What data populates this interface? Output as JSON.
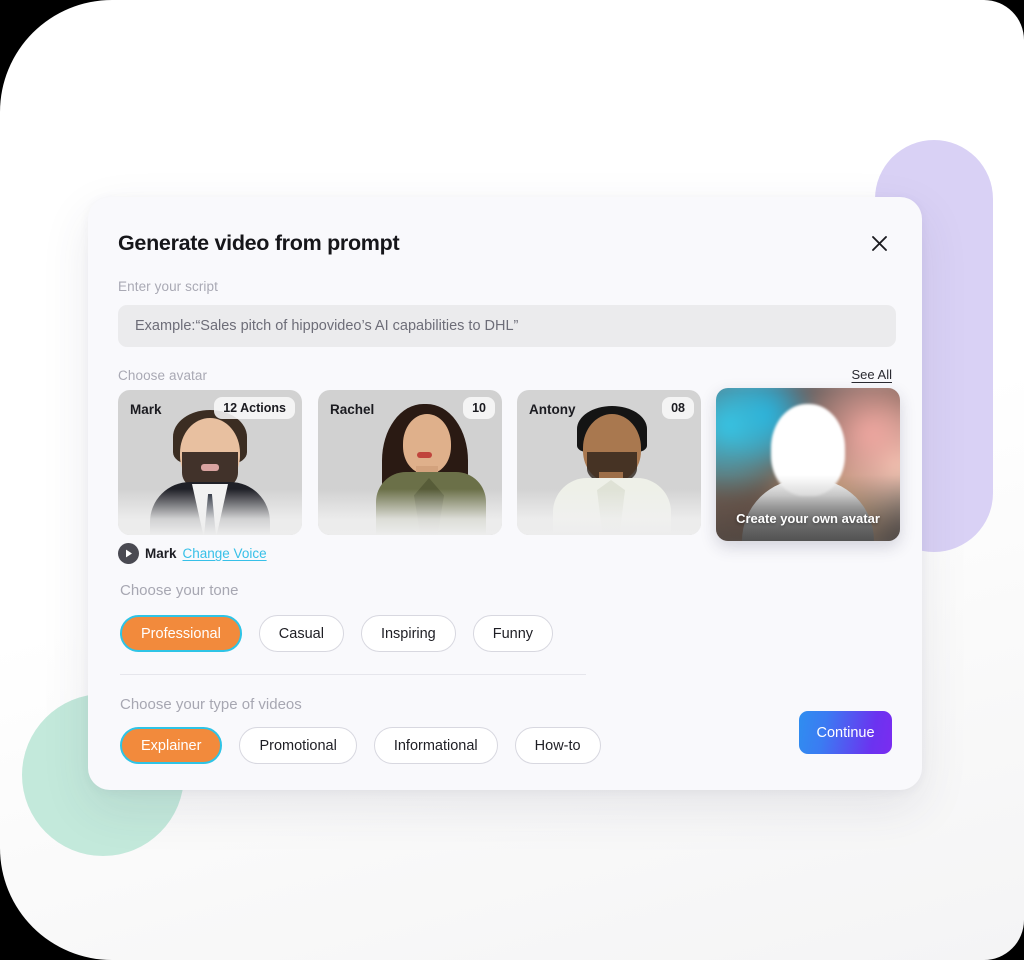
{
  "modal": {
    "title": "Generate video from prompt",
    "close_icon": "close-icon"
  },
  "script": {
    "label": "Enter your script",
    "placeholder": "Example:“Sales pitch of hippovideo’s AI capabilities to DHL”",
    "value": ""
  },
  "avatars": {
    "label": "Choose avatar",
    "see_all_label": "See All",
    "cards": [
      {
        "name": "Mark",
        "badge": "12 Actions",
        "selected": true
      },
      {
        "name": "Rachel",
        "badge": "10",
        "selected": false
      },
      {
        "name": "Antony",
        "badge": "08",
        "selected": false
      }
    ],
    "create_card": {
      "label": "Create your own avatar",
      "icon": "person-silhouette-icon"
    }
  },
  "voice": {
    "play_icon": "play-icon",
    "name": "Mark",
    "change_label": "Change Voice"
  },
  "tone": {
    "heading": "Choose your tone",
    "options": [
      {
        "label": "Professional",
        "selected": true
      },
      {
        "label": "Casual",
        "selected": false
      },
      {
        "label": "Inspiring",
        "selected": false
      },
      {
        "label": "Funny",
        "selected": false
      }
    ]
  },
  "video_type": {
    "heading": "Choose your type of videos",
    "options": [
      {
        "label": "Explainer",
        "selected": true
      },
      {
        "label": "Promotional",
        "selected": false
      },
      {
        "label": "Informational",
        "selected": false
      },
      {
        "label": "How-to",
        "selected": false
      }
    ]
  },
  "footer": {
    "continue_label": "Continue"
  },
  "colors": {
    "accent_orange": "#f28a3c",
    "accent_cyan": "#2ec4e6",
    "link_cyan": "#37c0e8",
    "continue_gradient_from": "#2f8ef0",
    "continue_gradient_to": "#7b2cf0",
    "blob_purple": "#d9d1f5",
    "blob_teal": "#c3e9db",
    "modal_bg": "#f9f9fc"
  }
}
